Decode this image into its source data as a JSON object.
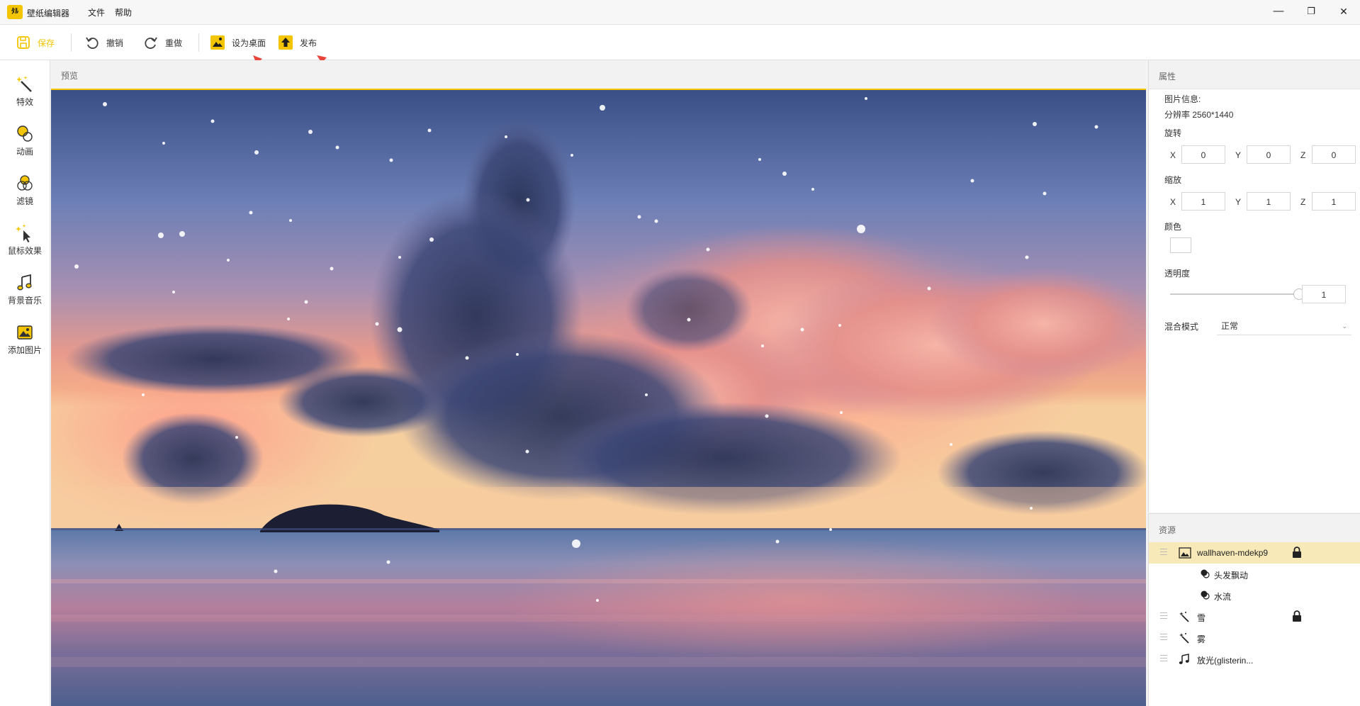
{
  "titlebar": {
    "logo_text": "ﾀﾙ",
    "app_title": "壁纸编辑器",
    "menu": [
      "文件",
      "帮助"
    ],
    "minimize": "—",
    "restore": "❐",
    "close": "✕"
  },
  "toolbar": {
    "save_label": "保存",
    "undo_label": "撤销",
    "redo_label": "重做",
    "set_desktop_label": "设为桌面",
    "publish_label": "发布"
  },
  "sidebar": {
    "items": [
      {
        "label": "特效",
        "icon": "magic-wand-icon"
      },
      {
        "label": "动画",
        "icon": "animation-icon"
      },
      {
        "label": "滤镜",
        "icon": "filter-icon"
      },
      {
        "label": "鼠标效果",
        "icon": "cursor-sparkle-icon"
      },
      {
        "label": "背景音乐",
        "icon": "music-note-icon"
      },
      {
        "label": "添加图片",
        "icon": "add-image-icon"
      }
    ]
  },
  "preview": {
    "title": "预览"
  },
  "properties": {
    "title": "属性",
    "image_info_label": "图片信息:",
    "resolution": "分辨率 2560*1440",
    "rotation_label": "旋转",
    "rotation": {
      "x_label": "X",
      "x": "0",
      "y_label": "Y",
      "y": "0",
      "z_label": "Z",
      "z": "0"
    },
    "scale_label": "缩放",
    "scale": {
      "x_label": "X",
      "x": "1",
      "y_label": "Y",
      "y": "1",
      "z_label": "Z",
      "z": "1"
    },
    "color_label": "颜色",
    "color_value": "#ffffff",
    "opacity_label": "透明度",
    "opacity_value": "1",
    "blend_label": "混合模式",
    "blend_value": "正常"
  },
  "resources": {
    "title": "资源",
    "items": [
      {
        "name": "wallhaven-mdekp9",
        "icon": "image-icon",
        "locked": true,
        "selected": true
      },
      {
        "name": "头发飘动",
        "icon": "animation-node-icon"
      },
      {
        "name": "水流",
        "icon": "animation-node-icon"
      },
      {
        "name": "雪",
        "icon": "magic-wand-icon",
        "locked": true
      },
      {
        "name": "雾",
        "icon": "magic-wand-icon"
      },
      {
        "name": "放光(glisterin...",
        "icon": "music-note-icon"
      }
    ]
  },
  "colors": {
    "accent": "#f2c500",
    "selected_row": "#f8e9b8",
    "annotation_arrow": "#e8453c"
  }
}
